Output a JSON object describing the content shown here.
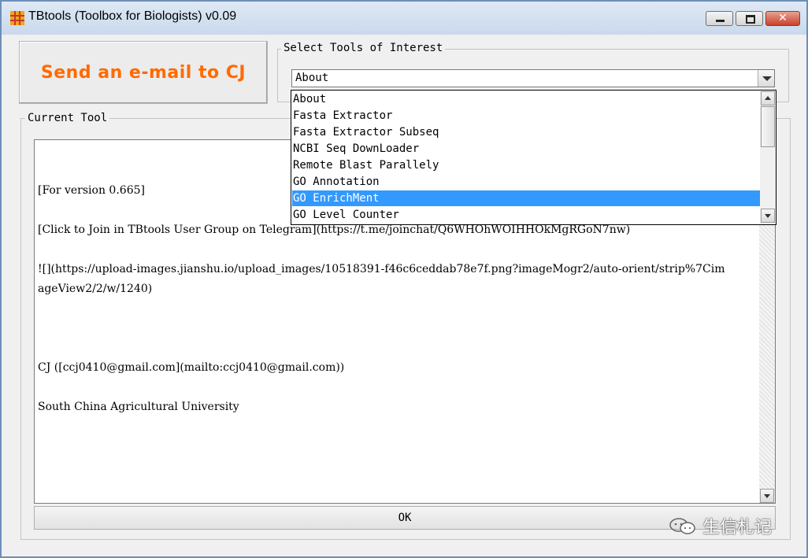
{
  "window": {
    "title": "TBtools (Toolbox for Biologists) v0.09",
    "close_symbol": "✕"
  },
  "send_email_button": {
    "label": "Send an e-mail to CJ",
    "color": "#ff6a00"
  },
  "select_tools": {
    "group_label": "Select Tools of Interest",
    "selected_value": "About",
    "options": [
      "About",
      "Fasta Extractor",
      "Fasta Extractor Subseq",
      "NCBI Seq DownLoader",
      "Remote Blast Parallely",
      "GO Annotation",
      "GO EnrichMent",
      "GO Level Counter"
    ],
    "highlighted_option": "GO EnrichMent",
    "highlight_color": "#3399ff"
  },
  "current_tool": {
    "group_label": "Current Tool",
    "lines": [
      "[For version 0.665]",
      "[Click to Join in TBtools User Group on Telegram](https://t.me/joinchat/Q6WHOhWOIHHOkMgRGoN7nw)",
      "![](https://upload-images.jianshu.io/upload_images/10518391-f46c6ceddab78e7f.png?imageMogr2/auto-orient/strip%7Cim",
      "ageView2/2/w/1240)",
      "CJ ([ccj0410@gmail.com](mailto:ccj0410@gmail.com))",
      "South China Agricultural University"
    ]
  },
  "ok_button": {
    "label": "OK"
  },
  "watermark": {
    "text": "生信札记",
    "icon": "wechat-icon"
  }
}
